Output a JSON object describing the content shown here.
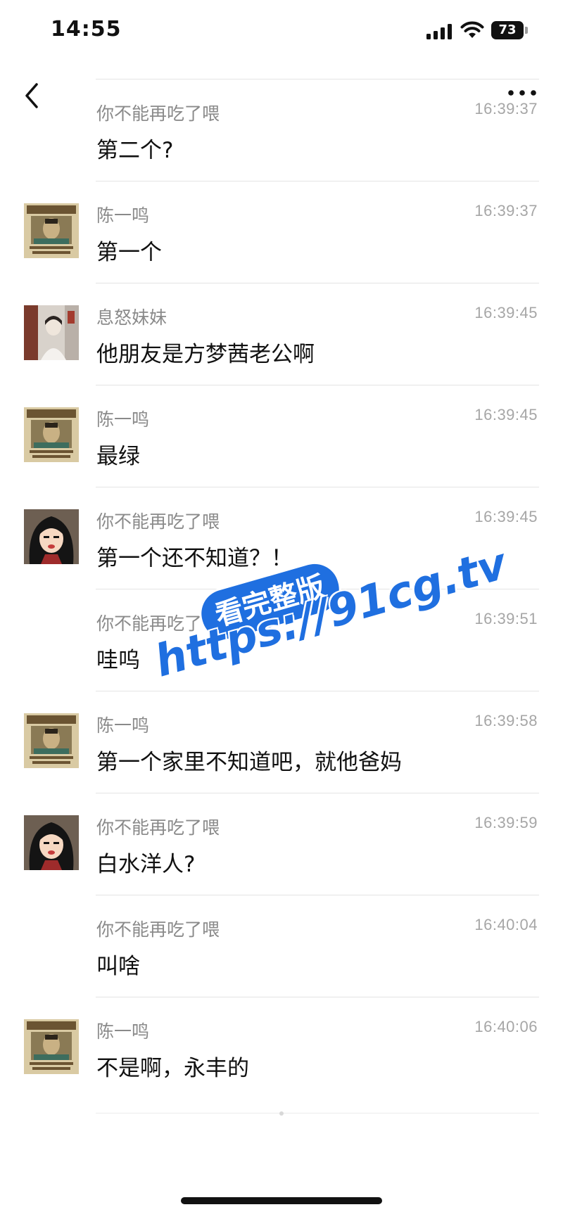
{
  "status_bar": {
    "time": "14:55",
    "battery": "73"
  },
  "nav": {
    "back_icon": "chevron-left-icon",
    "more_icon": "more-dots-icon"
  },
  "messages": [
    {
      "sender": "你不能再吃了喂",
      "time": "16:39:37",
      "text": "第二个?",
      "avatar": "none"
    },
    {
      "sender": "陈一鸣",
      "time": "16:39:37",
      "text": "第一个",
      "avatar": "wanted-poster"
    },
    {
      "sender": "息怒妹妹",
      "time": "16:39:45",
      "text": "他朋友是方梦茜老公啊",
      "avatar": "photo-girl"
    },
    {
      "sender": "陈一鸣",
      "time": "16:39:45",
      "text": "最绿",
      "avatar": "wanted-poster"
    },
    {
      "sender": "你不能再吃了喂",
      "time": "16:39:45",
      "text": "第一个还不知道？！",
      "avatar": "cartoon-face"
    },
    {
      "sender": "你不能再吃了喂",
      "time": "16:39:51",
      "text": "哇呜",
      "avatar": "none"
    },
    {
      "sender": "陈一鸣",
      "time": "16:39:58",
      "text": "第一个家里不知道吧，就他爸妈",
      "avatar": "wanted-poster"
    },
    {
      "sender": "你不能再吃了喂",
      "time": "16:39:59",
      "text": "白水洋人?",
      "avatar": "cartoon-face"
    },
    {
      "sender": "你不能再吃了喂",
      "time": "16:40:04",
      "text": "叫啥",
      "avatar": "none"
    },
    {
      "sender": "陈一鸣",
      "time": "16:40:06",
      "text": "不是啊，永丰的",
      "avatar": "wanted-poster"
    }
  ],
  "watermark": {
    "badge": "看完整版",
    "url": "https://91cg.tv",
    "color": "#1f6fe0"
  }
}
